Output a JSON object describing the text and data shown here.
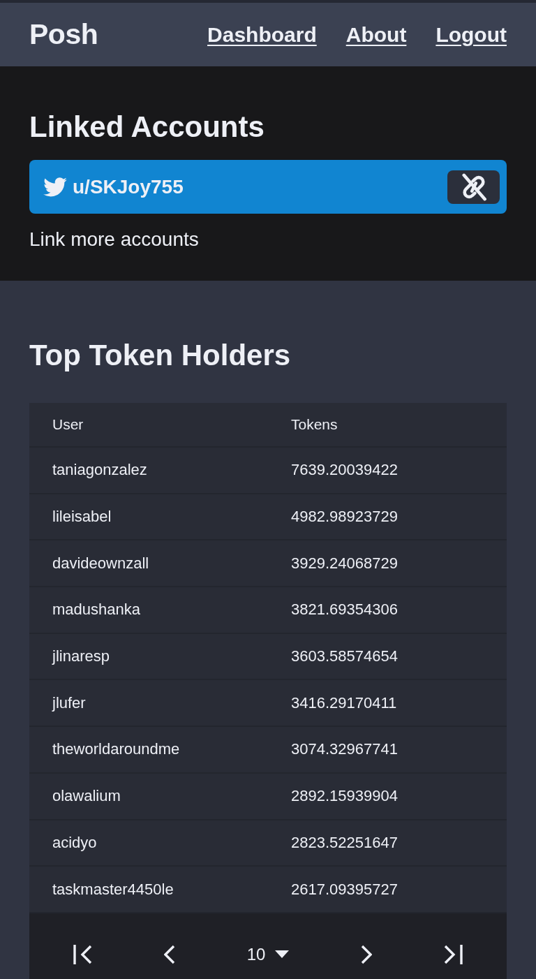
{
  "navbar": {
    "brand": "Posh",
    "links": [
      "Dashboard",
      "About",
      "Logout"
    ]
  },
  "linked_accounts": {
    "title": "Linked Accounts",
    "accounts": [
      {
        "kind": "twitter",
        "handle": "u/SKJoy755"
      }
    ],
    "link_more": "Link more accounts"
  },
  "top_token_holders": {
    "title": "Top Token Holders",
    "table": {
      "columns": [
        "User",
        "Tokens"
      ],
      "rows": [
        [
          "taniagonzalez",
          "7639.20039422"
        ],
        [
          "lileisabel",
          "4982.98923729"
        ],
        [
          "davideownzall",
          "3929.24068729"
        ],
        [
          "madushanka",
          "3821.69354306"
        ],
        [
          "jlinaresp",
          "3603.58574654"
        ],
        [
          "jlufer",
          "3416.29170411"
        ],
        [
          "theworldaroundme",
          "3074.32967741"
        ],
        [
          "olawalium",
          "2892.15939904"
        ],
        [
          "acidyo",
          "2823.52251647"
        ],
        [
          "taskmaster4450le",
          "2617.09395727"
        ]
      ]
    },
    "pagination": {
      "page_size": "10"
    }
  }
}
